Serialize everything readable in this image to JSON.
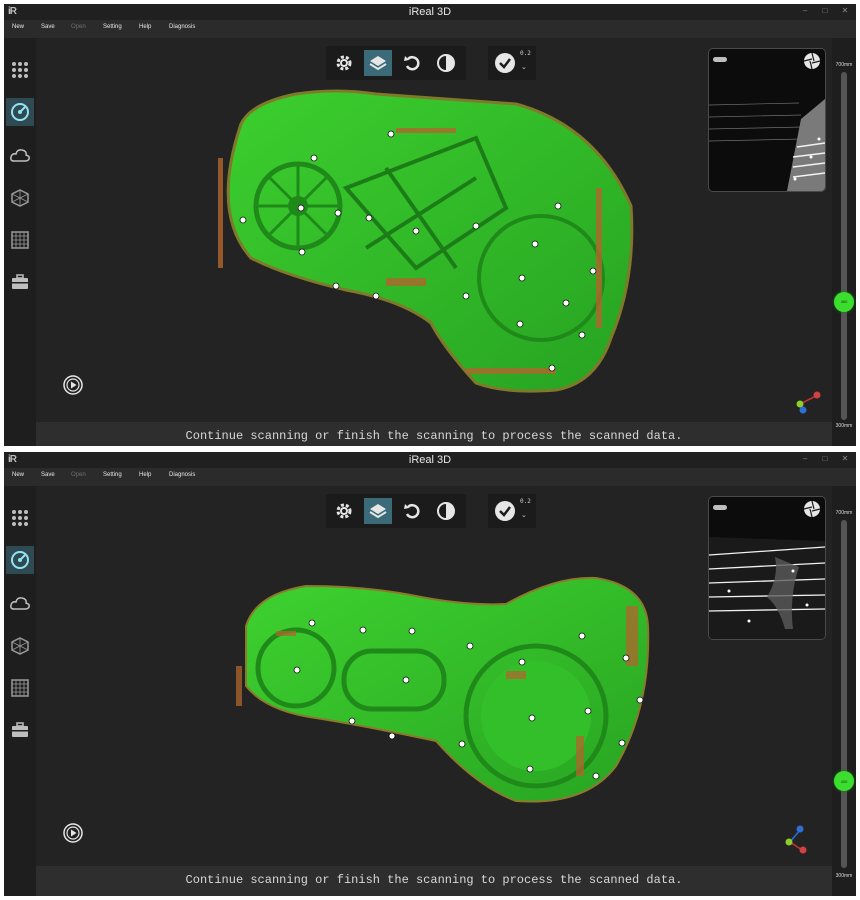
{
  "app": {
    "logo": "iR",
    "title": "iReal 3D"
  },
  "window_controls": [
    "–",
    "□",
    "✕"
  ],
  "menu": [
    {
      "label": "New",
      "enabled": true
    },
    {
      "label": "Save",
      "enabled": true
    },
    {
      "label": "Open",
      "enabled": false
    },
    {
      "label": "Setting",
      "enabled": true
    },
    {
      "label": "Help",
      "enabled": true
    },
    {
      "label": "Diagnosis",
      "enabled": true
    }
  ],
  "sidebar_icons": [
    "grid-dots-icon",
    "scan-icon",
    "cloud-icon",
    "mesh-icon",
    "grid-icon",
    "toolbox-icon"
  ],
  "toolbar_icons": [
    "gear-icon",
    "layers-icon",
    "undo-icon",
    "contrast-icon"
  ],
  "check_value": "0.2",
  "status_text": "Continue scanning or finish the scanning to process the scanned data.",
  "distance": {
    "top": "700mm",
    "bottom": "300mm"
  },
  "screens": [
    {
      "distance_fraction": 0.34,
      "knob_label": "460"
    },
    {
      "distance_fraction": 0.25,
      "knob_label": "400"
    }
  ],
  "colors": {
    "accent": "#3bdd2e",
    "model_green": "#2fb52a",
    "active_tab": "#3b6b78",
    "background": "#232323"
  }
}
